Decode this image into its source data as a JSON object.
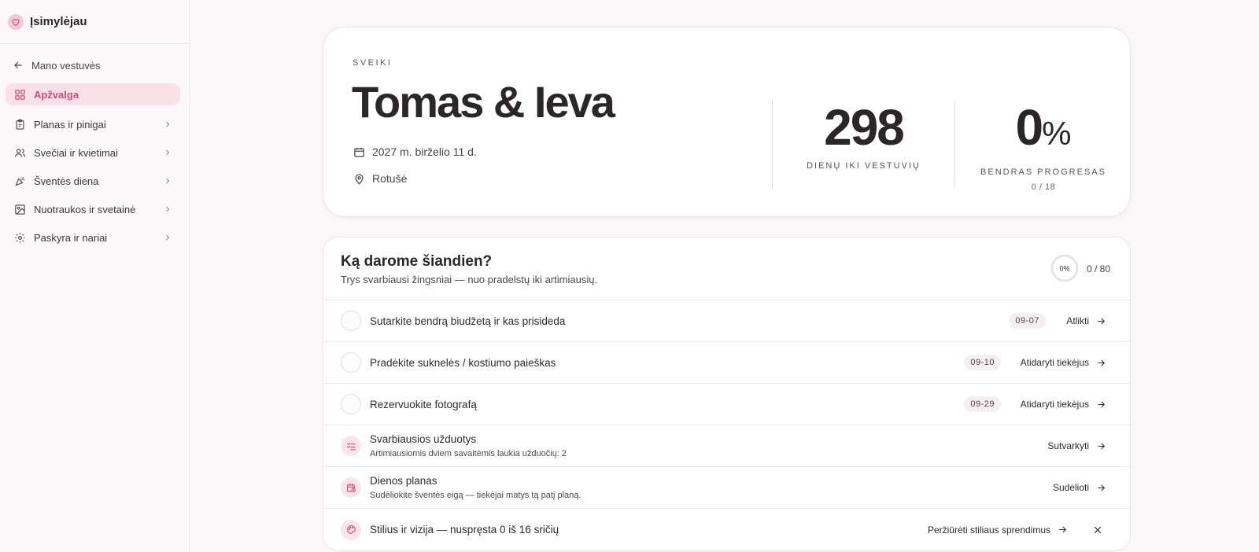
{
  "brand": {
    "name": "Įsimylėjau",
    "logo_icon": "heart-logo-icon",
    "accent": "#d14d73"
  },
  "sidebar": {
    "back_label": "Mano vestuvės",
    "items": [
      {
        "label": "Apžvalga",
        "icon": "dashboard-grid-icon",
        "active": true
      },
      {
        "label": "Planas ir pinigai",
        "icon": "clipboard-icon"
      },
      {
        "label": "Svečiai ir kvietimai",
        "icon": "users-icon"
      },
      {
        "label": "Šventės diena",
        "icon": "party-popper-icon"
      },
      {
        "label": "Nuotraukos ir svetainė",
        "icon": "image-icon"
      },
      {
        "label": "Paskyra ir nariai",
        "icon": "gear-icon"
      }
    ]
  },
  "hero": {
    "kicker": "SVEIKI",
    "title": "Tomas & Ieva",
    "date": "2027 m. birželio 11 d.",
    "location": "Rotušė",
    "days": {
      "value": "298",
      "label": "DIENŲ IKI VESTUVIŲ"
    },
    "progress": {
      "value": "0",
      "unit": "%",
      "label": "BENDRAS PROGRESAS",
      "sub": "0 / 18"
    }
  },
  "today": {
    "title": "Ką darome šiandien?",
    "subtitle": "Trys svarbiausi žingsniai — nuo pradelstų iki artimiausių.",
    "ring_label": "0%",
    "ring_fraction": 0,
    "count": "0 / 80",
    "tasks": [
      {
        "text": "Sutarkite bendrą biudžetą ir kas prisideda",
        "date": "09-07",
        "action": "Atlikti"
      },
      {
        "text": "Pradėkite suknelės / kostiumo paieškas",
        "date": "09-10",
        "action": "Atidaryti tiekėjus"
      },
      {
        "text": "Rezervuokite fotografą",
        "date": "09-29",
        "action": "Atidaryti tiekėjus"
      }
    ],
    "cards": [
      {
        "title": "Svarbiausios užduotys",
        "sub": "Artimiausiomis dviem savaitėmis laukia užduočių: 2",
        "action": "Sutvarkyti",
        "icon": "checklist-icon"
      },
      {
        "title": "Dienos planas",
        "sub": "Sudėliokite šventės eigą — tiekėjai matys tą patį planą.",
        "action": "Sudėlioti",
        "icon": "calendar-clock-icon"
      }
    ],
    "style_row": {
      "text": "Stilius ir vizija — nuspręsta 0 iš 16 sričių",
      "action": "Peržiūrėti stiliaus sprendimus",
      "icon": "palette-icon"
    }
  }
}
